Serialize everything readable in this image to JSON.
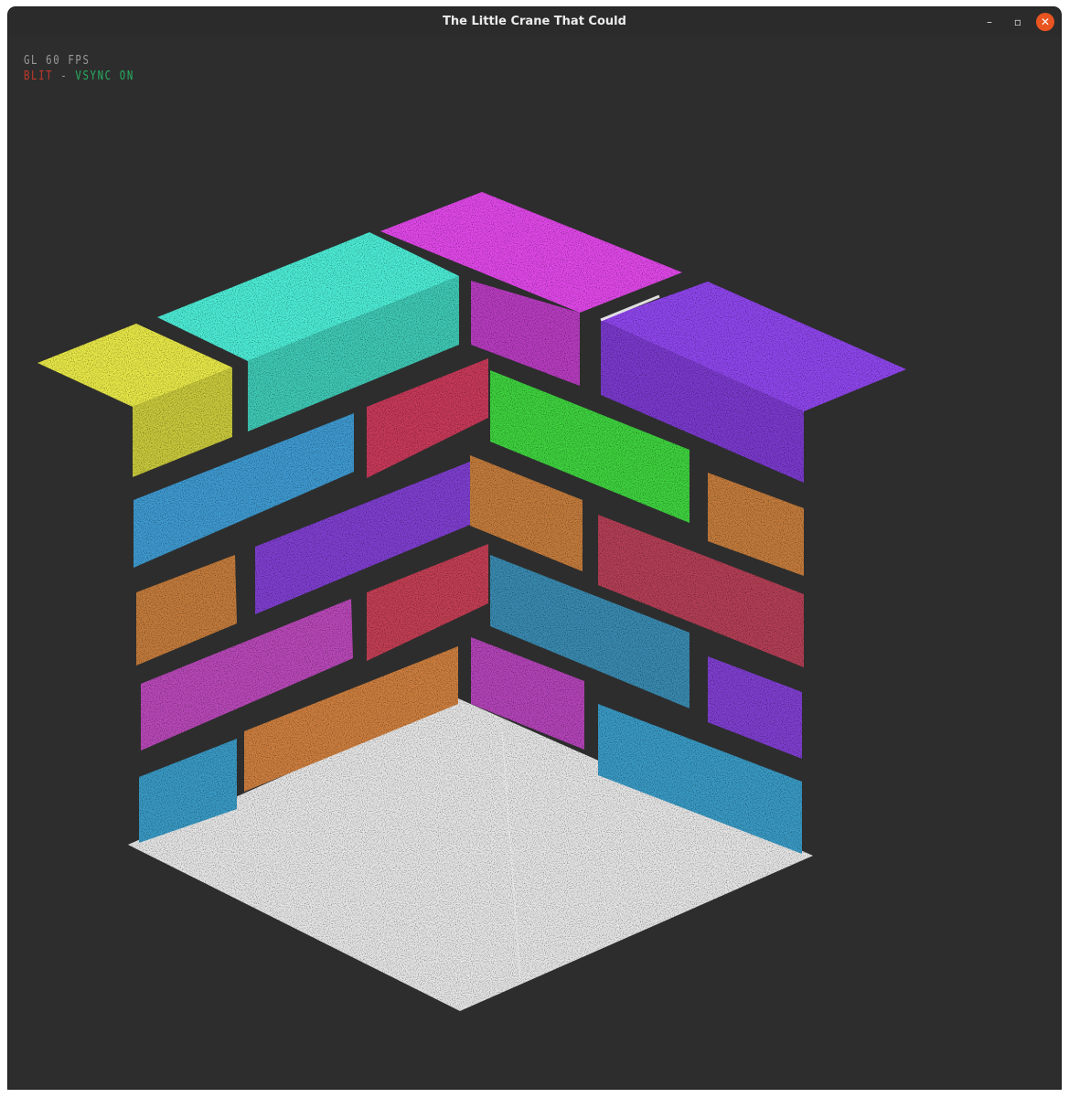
{
  "window": {
    "title": "The Little Crane That Could"
  },
  "controls": {
    "minimize_glyph": "–",
    "maximize_glyph": "▫",
    "close_glyph": "✕"
  },
  "hud": {
    "fps_text": "GL 60 FPS",
    "blit_text": "BLIT",
    "separator": "-",
    "vsync_text": "VSYNC ON"
  },
  "colors": {
    "accent_close": "#e95420",
    "background": "#2d2d2d",
    "blit": "#c0392b",
    "vsync": "#27ae60"
  }
}
